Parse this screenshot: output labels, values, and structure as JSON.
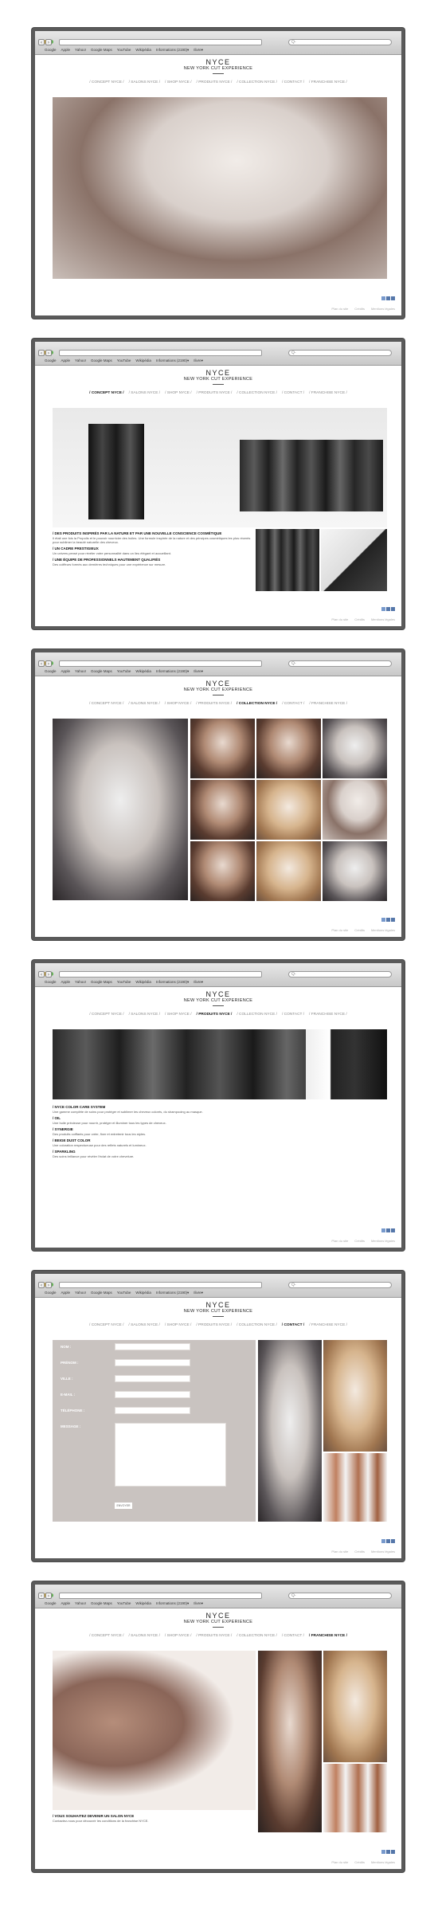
{
  "browser": {
    "bookmarks": [
      "Google",
      "Apple",
      "Yahoo!",
      "Google Maps",
      "YouTube",
      "Wikipédia",
      "Informations (2190)▾",
      "Ilivre▾"
    ]
  },
  "site": {
    "logo": "NYCE",
    "tagline": "NEW YORK CUT EXPERIENCE"
  },
  "menu": [
    "/ CONCEPT NYCE /",
    "/ SALONS NYCE /",
    "/ SHOP NYCE /",
    "/ PRODUITS NYCE /",
    "/ COLLECTION NYCE /",
    "/ CONTACT /",
    "/ FRANCHISE NYCE /"
  ],
  "footer": [
    "Plan du site",
    "Crédits",
    "Mentions légales"
  ],
  "pages": [
    {
      "active": -1
    },
    {
      "active": 0,
      "sections": [
        {
          "title": "/ DES PRODUITS INSPIRÉS PAR LA NATURE ET PAR UNE NOUVELLE CONSCIENCE COSMÉTIQUE",
          "text": "Il était une fois la Propolis et le pouvoir nourricier des huiles. Une formule inspirée de la nature et des principes cosmétiques les plus récents pour sublimer la beauté naturelle des cheveux."
        },
        {
          "title": "/ UN CADRE PRESTIGIEUX",
          "text": "Un univers pensé pour révéler votre personnalité dans un lieu élégant et accueillant."
        },
        {
          "title": "/ UNE ÉQUIPE DE PROFESSIONNELS HAUTEMENT QUALIFIÉS",
          "text": "Des coiffeurs formés aux dernières techniques pour une expérience sur mesure."
        }
      ]
    },
    {
      "active": 4
    },
    {
      "active": 3,
      "sections": [
        {
          "title": "/ NYCE COLOR CARE SYSTEM",
          "text": "Une gamme complète de soins pour protéger et sublimer les cheveux colorés, du shampooing au masque."
        },
        {
          "title": "/ OIL",
          "text": "Une huile précieuse pour nourrir, protéger et illuminer tous les types de cheveux."
        },
        {
          "title": "/ SYNERGIE",
          "text": "Des produits coiffants pour créer, fixer et entretenir tous les styles."
        },
        {
          "title": "/ BEIGE DUST COLOR",
          "text": "Une coloration respectueuse pour des reflets naturels et lumineux."
        },
        {
          "title": "/ SPARKLING",
          "text": "Des soins brillance pour révéler l'éclat de votre chevelure."
        }
      ]
    },
    {
      "active": 5,
      "form": {
        "fields": [
          "NOM :",
          "PRÉNOM :",
          "VILLE :",
          "E-MAIL :",
          "TÉLÉPHONE :",
          "MESSAGE :"
        ],
        "submit": "ENVOYER"
      }
    },
    {
      "active": 6,
      "sections": [
        {
          "title": "/ VOUS SOUHAITEZ DEVENIR UN SALON NYCE",
          "text": "Contactez-nous pour découvrir les conditions de la franchise NYCE."
        }
      ]
    }
  ]
}
